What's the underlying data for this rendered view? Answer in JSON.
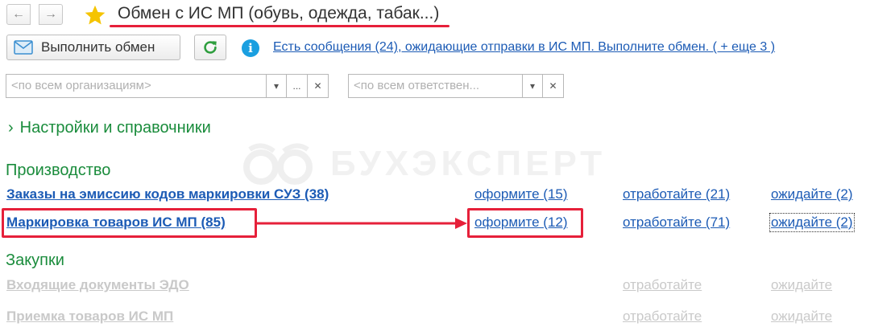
{
  "header": {
    "back_icon": "arrow-left-icon",
    "forward_icon": "arrow-right-icon",
    "favorite_icon": "star-icon",
    "title": "Обмен с ИС МП (обувь, одежда, табак...)"
  },
  "toolbar": {
    "exchange_button_label": "Выполнить обмен",
    "exchange_icon": "envelope-icon",
    "refresh_icon": "refresh-icon",
    "info_icon": "info-icon",
    "messages_link": "Есть сообщения (24), ожидающие отправки в ИС МП. Выполните обмен. ( + еще 3 )"
  },
  "filters": {
    "organization_placeholder": "<по всем организациям>",
    "responsible_placeholder": "<по всем ответствен...",
    "more_label": "...",
    "clear_label": "✕",
    "dropdown_label": "▾"
  },
  "settings": {
    "label": "Настройки и справочники"
  },
  "watermark": {
    "text": "БУХЭКСПЕРТ"
  },
  "sections": {
    "production": {
      "title": "Производство",
      "rows": [
        {
          "label": "Заказы на эмиссию кодов маркировки СУЗ (38)",
          "prepare": "оформите (15)",
          "process": "отработайте (21)",
          "wait": "ожидайте (2)"
        },
        {
          "label": "Маркировка товаров ИС МП (85)",
          "prepare": "оформите (12)",
          "process": "отработайте (71)",
          "wait": "ожидайте (2)"
        }
      ]
    },
    "purchases": {
      "title": "Закупки",
      "rows": [
        {
          "label": "Входящие документы ЭДО",
          "process": "отработайте",
          "wait": "ожидайте"
        },
        {
          "label": "Приемка товаров ИС МП",
          "process": "отработайте",
          "wait": "ожидайте"
        }
      ]
    }
  },
  "colors": {
    "accent_green": "#1a8c3c",
    "link_blue": "#1c5bb5",
    "highlight_red": "#e6203a",
    "star_yellow": "#f5c400",
    "disabled_gray": "#c9c9c9"
  }
}
